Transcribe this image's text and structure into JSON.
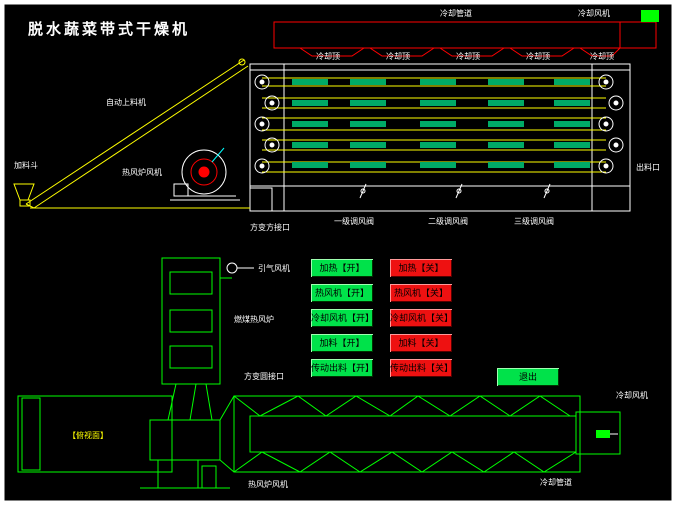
{
  "title": "脱水蔬菜带式干燥机",
  "labels": {
    "cooling_duct_top": "冷却管道",
    "cooling_fan_top": "冷却风机",
    "cooling_tops": [
      "冷却顶",
      "冷却顶",
      "冷却顶",
      "冷却顶",
      "冷却顶"
    ],
    "auto_feeder": "自动上料机",
    "hot_air_fan": "热风炉风机",
    "feed_hopper": "加料斗",
    "discharge": "出料口",
    "square_port": "方变方接口",
    "damper_1": "一级调风阀",
    "damper_2": "二级调风阀",
    "damper_3": "三级调风阀",
    "induced_fan": "引气风机",
    "coal_furnace": "燃煤热风炉",
    "round_port": "方变圆接口",
    "side_view_hint": "【俯视面】",
    "cooling_fan_bottom": "冷却风机",
    "cooling_duct_bottom": "冷却管道",
    "hot_air_fan_bottom": "热风炉风机"
  },
  "controls": {
    "on": [
      "加热【开】",
      "热风机【开】",
      "冷却风机【开】",
      "加料【开】",
      "传动出料【开】"
    ],
    "off": [
      "加热【关】",
      "热风机【关】",
      "冷却风机【关】",
      "加料【关】",
      "传动出料【关】"
    ],
    "exit": "退出"
  },
  "colors": {
    "background": "#000000",
    "frame": "#ffffff",
    "line_green": "#00ff00",
    "line_yellow": "#ffff00",
    "duct_red": "#ff0000",
    "btn_on": "#00e24a",
    "btn_off": "#ee1111"
  }
}
